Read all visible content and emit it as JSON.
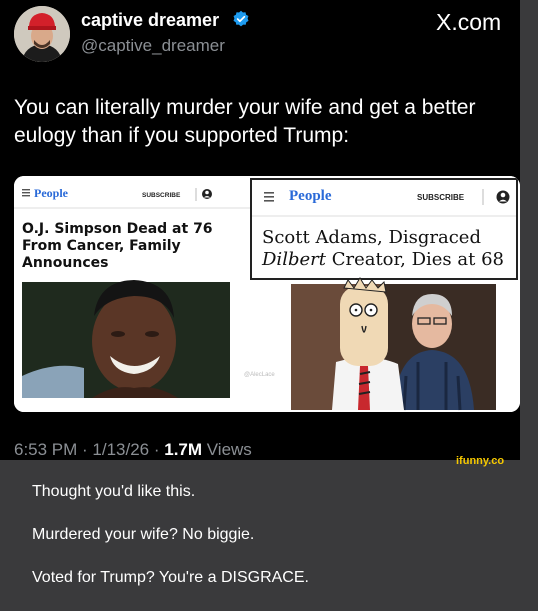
{
  "tweet": {
    "display_name": "captive dreamer",
    "handle": "@captive_dreamer",
    "site": "X.com",
    "text": "You can literally murder your wife and get a better eulogy than if you supported Trump:",
    "timestamp": "6:53 PM · 1/13/26 · ",
    "views_count": "1.7M",
    "views_label": " Views"
  },
  "cards": {
    "left": {
      "brand": "People",
      "subscribe": "SUBSCRIBE",
      "headline_line1": "O.J. Simpson Dead at 76",
      "headline_line2": "From Cancer, Family",
      "headline_line3": "Announces",
      "credit": "@AlecLace"
    },
    "right": {
      "brand": "People",
      "subscribe": "SUBSCRIBE",
      "headline_line1": "Scott Adams, Disgraced",
      "headline_line2_italic": "Dilbert",
      "headline_line2_rest": " Creator, Dies at 68"
    }
  },
  "watermark": "ifunny.co",
  "note": {
    "line1": "Thought you'd like this.",
    "line2": "Murdered your wife? No biggie.",
    "line3": "Voted for Trump? You're a DISGRACE."
  },
  "colors": {
    "background": "#3a3a3c",
    "tweet_bg": "#000000",
    "verified": "#1d9bf0",
    "people_blue": "#2a6ad8",
    "watermark": "#f5c800"
  }
}
